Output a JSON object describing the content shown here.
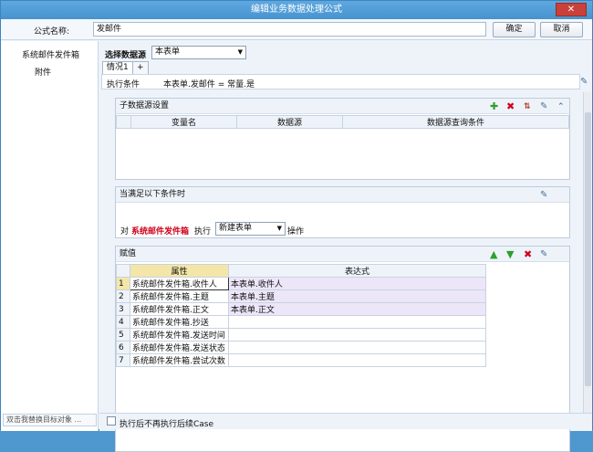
{
  "window": {
    "title": "编辑业务数据处理公式",
    "close_label": "✕"
  },
  "formula": {
    "name_label": "公式名称:",
    "name_value": "发邮件",
    "ok_label": "确定",
    "cancel_label": "取消"
  },
  "sidebar": {
    "items": [
      {
        "label": "系统邮件发件箱"
      },
      {
        "label": "附件"
      }
    ],
    "hint": "双击我替换目标对象 ..."
  },
  "datasource": {
    "label": "选择数据源",
    "value": "本表单"
  },
  "tabs": [
    {
      "label": "情况1"
    },
    {
      "label": "+"
    }
  ],
  "condition": {
    "label": "执行条件",
    "value": "本表单.发邮件 = 常量.是"
  },
  "subsource": {
    "title": "子数据源设置",
    "columns": [
      "变量名",
      "数据源",
      "数据源查询条件"
    ]
  },
  "when": {
    "title": "当满足以下条件时",
    "pre": "对",
    "target": "系统邮件发件箱",
    "mid": "执行",
    "action": "新建表单",
    "post": "操作"
  },
  "assign": {
    "title": "赋值",
    "col_attr": "属性",
    "col_expr": "表达式",
    "rows": [
      {
        "no": "1",
        "attr": "系统邮件发件箱.收件人",
        "expr": "本表单.收件人"
      },
      {
        "no": "2",
        "attr": "系统邮件发件箱.主题",
        "expr": "本表单.主题"
      },
      {
        "no": "3",
        "attr": "系统邮件发件箱.正文",
        "expr": "本表单.正文"
      },
      {
        "no": "4",
        "attr": "系统邮件发件箱.抄送",
        "expr": ""
      },
      {
        "no": "5",
        "attr": "系统邮件发件箱.发送时间",
        "expr": ""
      },
      {
        "no": "6",
        "attr": "系统邮件发件箱.发送状态",
        "expr": ""
      },
      {
        "no": "7",
        "attr": "系统邮件发件箱.尝试次数",
        "expr": ""
      }
    ]
  },
  "footer": {
    "checkbox_label": "执行后不再执行后续Case"
  },
  "colors": {
    "title_bg": "#4793cf",
    "accent_red": "#d0021b",
    "add_green": "#2e9e2e"
  }
}
